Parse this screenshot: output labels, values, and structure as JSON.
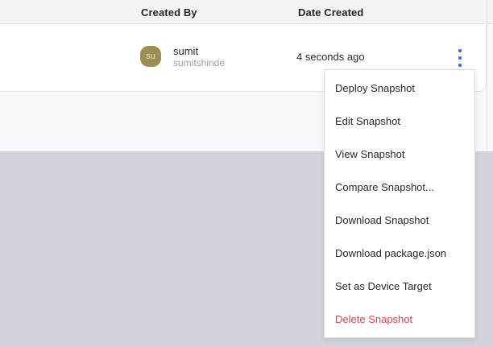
{
  "table": {
    "columns": [
      "Created By",
      "Date Created"
    ],
    "row": {
      "avatar_initials": "su",
      "name": "sumit",
      "username": "sumitshinde",
      "date_created": "4 seconds ago"
    }
  },
  "menu": {
    "items": [
      {
        "label": "Deploy Snapshot"
      },
      {
        "label": "Edit Snapshot"
      },
      {
        "label": "View Snapshot"
      },
      {
        "label": "Compare Snapshot..."
      },
      {
        "label": "Download Snapshot"
      },
      {
        "label": "Download package.json"
      },
      {
        "label": "Set as Device Target"
      },
      {
        "label": "Delete Snapshot"
      }
    ]
  },
  "icons": {
    "kebab": "kebab-vertical-dots-icon"
  },
  "colors": {
    "accent_blue": "#3f6bf0",
    "danger_red": "#d9434f",
    "avatar_olive": "#9c8f55",
    "section_gray": "#d1d4da",
    "header_gray": "#f1f3f5"
  }
}
